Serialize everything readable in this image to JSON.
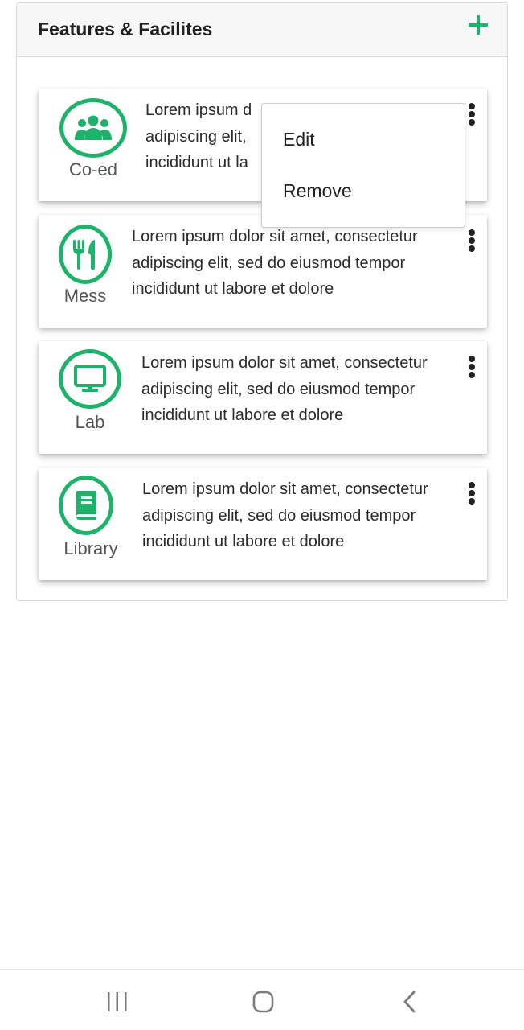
{
  "panel": {
    "title": "Features & Facilites"
  },
  "icons": {
    "add": "plus-icon",
    "more": "more-vertical-icon"
  },
  "colors": {
    "accent": "#1db36b"
  },
  "cards": [
    {
      "label": "Co-ed",
      "icon": "users-group-icon",
      "description_lines": [
        "Lorem ipsum d",
        "adipiscing elit,",
        "incididunt ut la"
      ]
    },
    {
      "label": "Mess",
      "icon": "fork-knife-icon",
      "description_lines": [
        "Lorem ipsum dolor sit amet, consectetur",
        "adipiscing elit, sed do eiusmod tempor",
        "incididunt ut labore et dolore"
      ]
    },
    {
      "label": "Lab",
      "icon": "monitor-icon",
      "description_lines": [
        "Lorem ipsum dolor sit amet, consectetur",
        "adipiscing elit, sed do eiusmod tempor",
        "incididunt ut labore et dolore"
      ]
    },
    {
      "label": "Library",
      "icon": "book-icon",
      "description_lines": [
        "Lorem ipsum dolor sit amet, consectetur",
        "adipiscing elit, sed do eiusmod tempor",
        "incididunt ut labore et dolore"
      ]
    }
  ],
  "context_menu": {
    "items": [
      "Edit",
      "Remove"
    ]
  },
  "navbar": {
    "recents": "recent-apps-icon",
    "home": "home-icon",
    "back": "back-icon"
  }
}
